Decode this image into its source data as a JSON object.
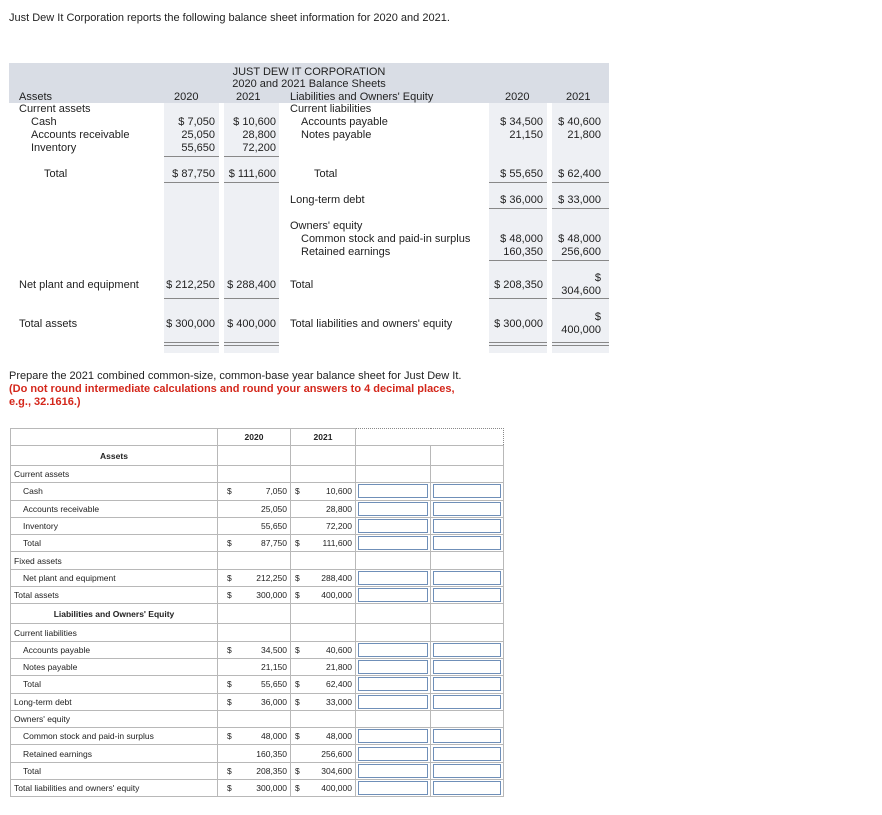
{
  "intro": "Just Dew It Corporation reports the following balance sheet information for 2020 and 2021.",
  "balance_sheet": {
    "company": "JUST DEW IT CORPORATION",
    "subtitle": "2020 and 2021 Balance Sheets",
    "assets_header": "Assets",
    "liab_header": "Liabilities and Owners' Equity",
    "year1": "2020",
    "year2": "2021",
    "current_assets": "Current assets",
    "cash": {
      "label": "Cash",
      "v1": "$ 7,050",
      "v2": "$ 10,600"
    },
    "ar": {
      "label": "Accounts receivable",
      "v1": "25,050",
      "v2": "28,800"
    },
    "inv": {
      "label": "Inventory",
      "v1": "55,650",
      "v2": "72,200"
    },
    "ca_total": {
      "label": "Total",
      "v1": "$ 87,750",
      "v2": "$ 111,600"
    },
    "current_liabilities": "Current liabilities",
    "ap": {
      "label": "Accounts payable",
      "v1": "$ 34,500",
      "v2": "$ 40,600"
    },
    "np": {
      "label": "Notes payable",
      "v1": "21,150",
      "v2": "21,800"
    },
    "cl_total": {
      "label": "Total",
      "v1": "$ 55,650",
      "v2": "$ 62,400"
    },
    "ltd": {
      "label": "Long-term debt",
      "v1": "$ 36,000",
      "v2": "$ 33,000"
    },
    "owners_equity": "Owners' equity",
    "cs": {
      "label": "Common stock and paid-in surplus",
      "v1": "$ 48,000",
      "v2": "$ 48,000"
    },
    "re": {
      "label": "Retained earnings",
      "v1": "160,350",
      "v2": "256,600"
    },
    "npe": {
      "label": "Net plant and equipment",
      "v1": "$ 212,250",
      "v2": "$ 288,400"
    },
    "oe_total": {
      "label": "Total",
      "v1": "$ 208,350",
      "v2_sym": "$",
      "v2": "304,600"
    },
    "ta": {
      "label": "Total assets",
      "v1": "$ 300,000",
      "v2": "$ 400,000"
    },
    "tle": {
      "label": "Total liabilities and owners' equity",
      "v1": "$ 300,000",
      "v2_sym": "$",
      "v2": "400,000"
    }
  },
  "prompt": {
    "text": "Prepare the 2021 combined common-size, common-base year balance sheet for Just Dew It.",
    "bold": "(Do not round intermediate calculations and round your answers to 4 decimal places, e.g., 32.1616.)"
  },
  "table": {
    "col_2020": "2020",
    "col_2021": "2021",
    "assets_heading": "Assets",
    "liab_heading": "Liabilities and Owners' Equity",
    "current_assets": "Current assets",
    "fixed_assets": "Fixed assets",
    "current_liabilities": "Current liabilities",
    "owners_equity": "Owners' equity",
    "dollar": "$",
    "rows": {
      "cash": {
        "label": "Cash",
        "a": "7,050",
        "b": "10,600"
      },
      "ar": {
        "label": "Accounts receivable",
        "a": "25,050",
        "b": "28,800"
      },
      "inv": {
        "label": "Inventory",
        "a": "55,650",
        "b": "72,200"
      },
      "ca_total": {
        "label": "Total",
        "a": "87,750",
        "b": "111,600"
      },
      "npe": {
        "label": "Net plant and equipment",
        "a": "212,250",
        "b": "288,400"
      },
      "ta": {
        "label": "Total assets",
        "a": "300,000",
        "b": "400,000"
      },
      "ap": {
        "label": "Accounts payable",
        "a": "34,500",
        "b": "40,600"
      },
      "np": {
        "label": "Notes payable",
        "a": "21,150",
        "b": "21,800"
      },
      "cl_total": {
        "label": "Total",
        "a": "55,650",
        "b": "62,400"
      },
      "ltd": {
        "label": "Long-term debt",
        "a": "36,000",
        "b": "33,000"
      },
      "cs": {
        "label": "Common stock and paid-in surplus",
        "a": "48,000",
        "b": "48,000"
      },
      "re": {
        "label": "Retained earnings",
        "a": "160,350",
        "b": "256,600"
      },
      "oe_total": {
        "label": "Total",
        "a": "208,350",
        "b": "304,600"
      },
      "tle": {
        "label": "Total liabilities and owners' equity",
        "a": "300,000",
        "b": "400,000"
      }
    }
  }
}
